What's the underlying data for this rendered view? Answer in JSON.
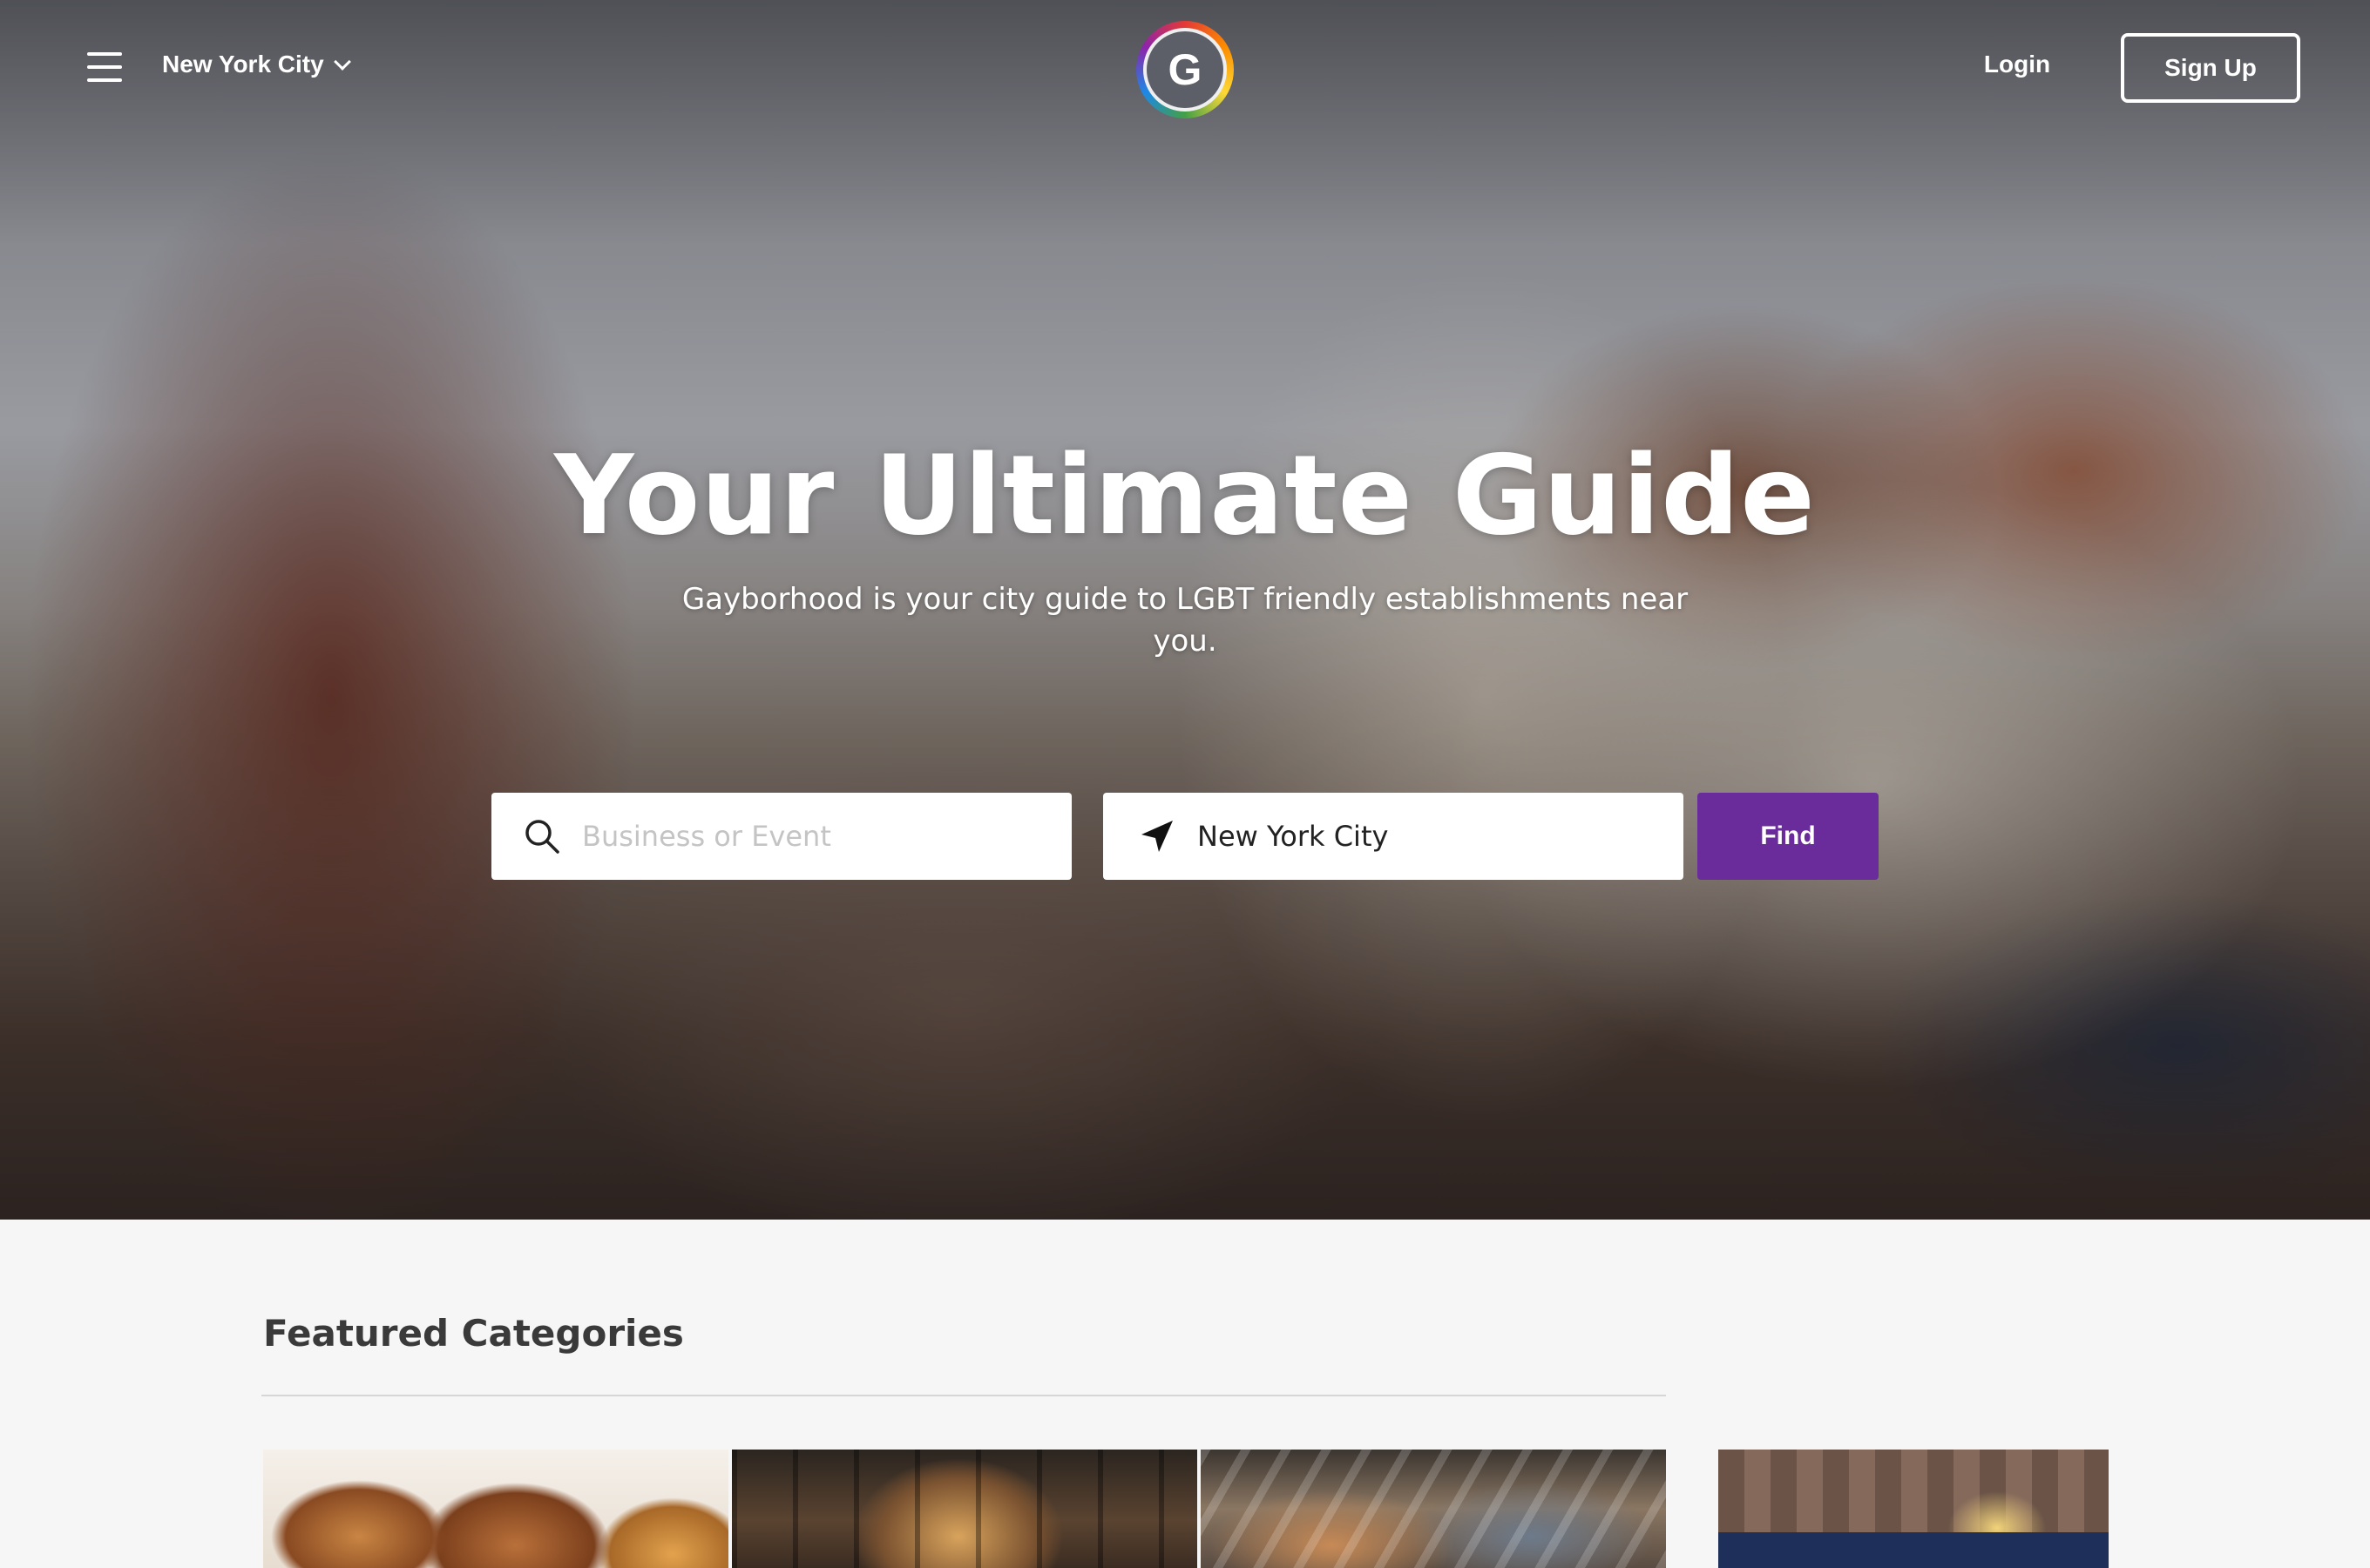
{
  "header": {
    "menu_icon": "hamburger-menu-icon",
    "city": "New York City",
    "city_chevron_icon": "chevron-down-icon",
    "logo_letter": "G",
    "login_label": "Login",
    "signup_label": "Sign Up"
  },
  "hero": {
    "headline": "Your Ultimate Guide",
    "subheadline": "Gayborhood is your city guide to LGBT friendly establishments near you."
  },
  "search": {
    "query_placeholder": "Business or Event",
    "query_value": "",
    "query_icon": "search-icon",
    "location_value": "New York City",
    "location_icon": "location-arrow-icon",
    "find_label": "Find"
  },
  "featured": {
    "title": "Featured Categories"
  },
  "colors": {
    "accent": "#6a2c9b",
    "text_dark": "#3a3a3a",
    "background": "#f6f6f6"
  }
}
